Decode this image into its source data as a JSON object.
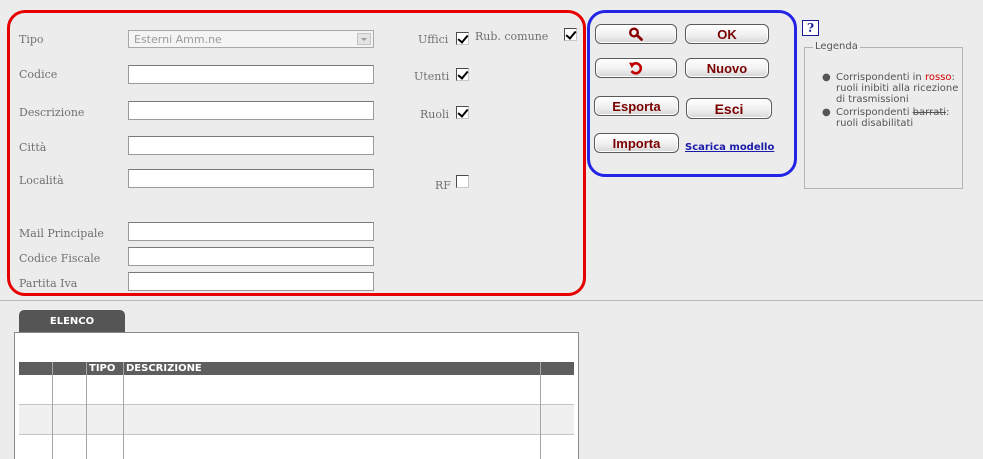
{
  "form": {
    "tipo_label": "Tipo",
    "tipo_value": "Esterni Amm.ne",
    "codice_label": "Codice",
    "descrizione_label": "Descrizione",
    "citta_label": "Città",
    "localita_label": "Località",
    "mail_label": "Mail Principale",
    "codice_fiscale_label": "Codice Fiscale",
    "partita_iva_label": "Partita Iva",
    "uffici_label": "Uffici",
    "uffici_checked": true,
    "rub_comune_label": "Rub. comune",
    "rub_comune_checked": true,
    "utenti_label": "Utenti",
    "utenti_checked": true,
    "ruoli_label": "Ruoli",
    "ruoli_checked": true,
    "rf_label": "RF",
    "rf_checked": false
  },
  "buttons": {
    "search_icon": "magnifier-icon",
    "ok": "OK",
    "reset_icon": "undo-arrow-icon",
    "nuovo": "Nuovo",
    "esporta": "Esporta",
    "esci": "Esci",
    "importa": "Importa",
    "scarica_modello": "Scarica modello"
  },
  "legend": {
    "help_icon_text": "?",
    "title": "Legenda",
    "item1_a": "Corrispondenti in",
    "item1_red": "rosso",
    "item1_b": ": ruoli inibiti alla ricezione di trasmissioni",
    "item2_a": "Corrispondenti",
    "item2_strike": "barrati",
    "item2_b": ": ruoli disabilitati"
  },
  "list": {
    "tab_label": "ELENCO",
    "columns": [
      "",
      "",
      "TIPO",
      "DESCRIZIONE",
      ""
    ]
  },
  "colors": {
    "highlight_red": "#e60000",
    "highlight_blue": "#2424e6",
    "button_text": "#7a0000",
    "link": "#1a1aa8"
  }
}
